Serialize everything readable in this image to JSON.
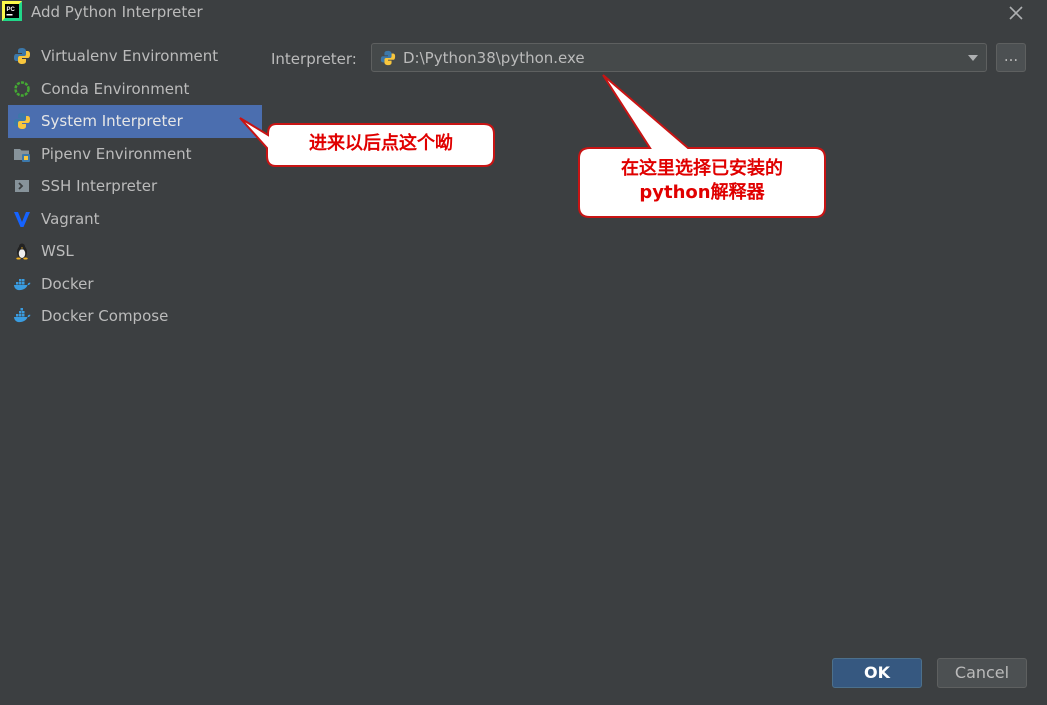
{
  "window": {
    "title": "Add Python Interpreter"
  },
  "sidebar": {
    "items": [
      {
        "label": "Virtualenv Environment",
        "icon": "python-icon"
      },
      {
        "label": "Conda Environment",
        "icon": "conda-icon"
      },
      {
        "label": "System Interpreter",
        "icon": "python-icon",
        "selected": true
      },
      {
        "label": "Pipenv Environment",
        "icon": "pipenv-folder-icon"
      },
      {
        "label": "SSH Interpreter",
        "icon": "terminal-icon"
      },
      {
        "label": "Vagrant",
        "icon": "vagrant-icon"
      },
      {
        "label": "WSL",
        "icon": "linux-penguin-icon"
      },
      {
        "label": "Docker",
        "icon": "docker-icon"
      },
      {
        "label": "Docker Compose",
        "icon": "docker-icon"
      }
    ]
  },
  "form": {
    "interpreter_label": "Interpreter:",
    "interpreter_value": "D:\\Python38\\python.exe",
    "browse_label": "..."
  },
  "annotations": {
    "callout1": "进来以后点这个呦",
    "callout2_line1": "在这里选择已安装的",
    "callout2_line2": "python解释器"
  },
  "buttons": {
    "ok": "OK",
    "cancel": "Cancel"
  },
  "colors": {
    "selection": "#4b6eaf",
    "background": "#3c3f41",
    "callout_text": "#e00000",
    "ok_button": "#365880"
  }
}
